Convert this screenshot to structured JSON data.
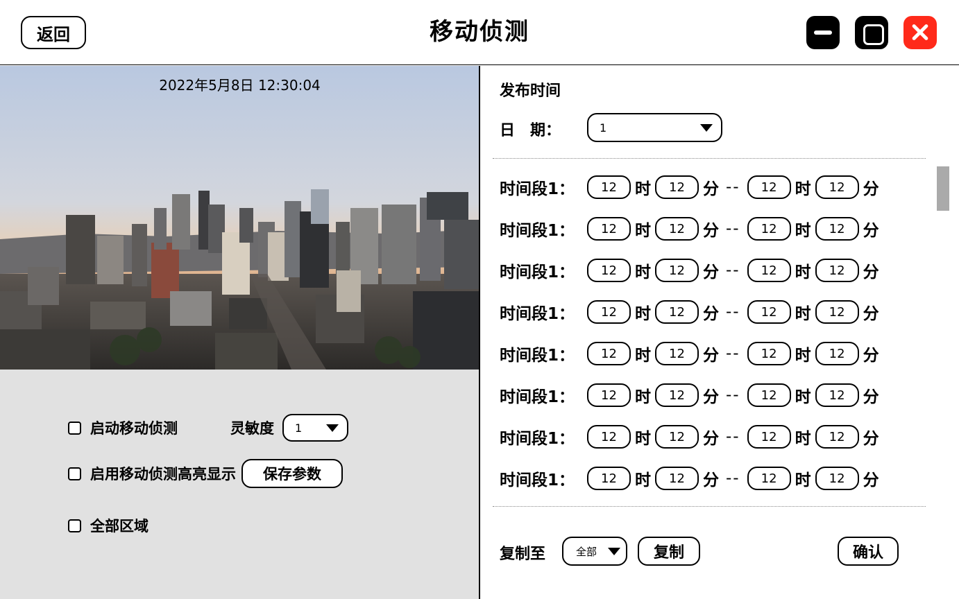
{
  "header": {
    "back_label": "返回",
    "title": "移动侦测",
    "minimize_icon": "minimize-icon",
    "maximize_icon": "maximize-icon",
    "close_icon": "close-icon",
    "close_color": "#ff2a1a"
  },
  "camera": {
    "timestamp": "2022年5月8日 12:30:04"
  },
  "left_options": {
    "enable_motion": "启动移动侦测",
    "sensitivity_label": "灵敏度",
    "sensitivity_value": "1",
    "highlight_label": "启用移动侦测高亮显示",
    "save_label": "保存参数",
    "all_areas_label": "全部区域"
  },
  "schedule": {
    "section_title": "发布时间",
    "date_label": "日　期：",
    "date_value": "1",
    "periods": [
      {
        "label": "时间段1：",
        "start_h": "12",
        "start_m": "12",
        "end_h": "12",
        "end_m": "12"
      },
      {
        "label": "时间段1：",
        "start_h": "12",
        "start_m": "12",
        "end_h": "12",
        "end_m": "12"
      },
      {
        "label": "时间段1：",
        "start_h": "12",
        "start_m": "12",
        "end_h": "12",
        "end_m": "12"
      },
      {
        "label": "时间段1：",
        "start_h": "12",
        "start_m": "12",
        "end_h": "12",
        "end_m": "12"
      },
      {
        "label": "时间段1：",
        "start_h": "12",
        "start_m": "12",
        "end_h": "12",
        "end_m": "12"
      },
      {
        "label": "时间段1：",
        "start_h": "12",
        "start_m": "12",
        "end_h": "12",
        "end_m": "12"
      },
      {
        "label": "时间段1：",
        "start_h": "12",
        "start_m": "12",
        "end_h": "12",
        "end_m": "12"
      },
      {
        "label": "时间段1：",
        "start_h": "12",
        "start_m": "12",
        "end_h": "12",
        "end_m": "12"
      }
    ],
    "hour_unit": "时",
    "minute_unit": "分",
    "separator": "--",
    "copy_to_label": "复制至",
    "copy_target": "全部",
    "copy_button": "复制",
    "confirm_button": "确认"
  }
}
